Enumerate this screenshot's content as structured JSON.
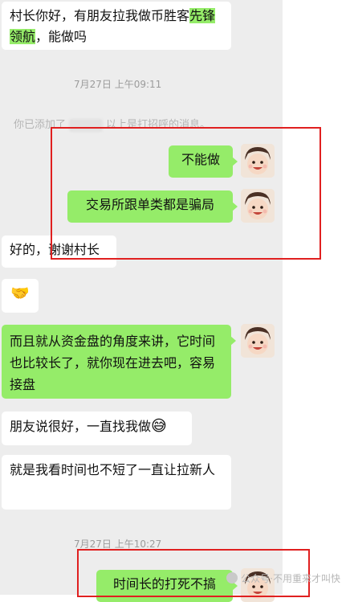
{
  "messages": [
    {
      "id": "m1",
      "side": "in",
      "parts": [
        "村长你好，有朋友拉我做币胜客",
        "先锋领航",
        "，能做吗"
      ]
    },
    {
      "id": "t1",
      "type": "time",
      "text": "7月27日 上午09:11"
    },
    {
      "id": "s1",
      "type": "system",
      "before": "你已添加了",
      "after": "以上是打招呼的消息。"
    },
    {
      "id": "m2",
      "side": "out",
      "text": "不能做"
    },
    {
      "id": "m3",
      "side": "out",
      "text": "交易所跟单类都是骗局"
    },
    {
      "id": "m4",
      "side": "in",
      "text": "好的，谢谢村长"
    },
    {
      "id": "m5",
      "side": "in",
      "emoji": "🤝"
    },
    {
      "id": "m6",
      "side": "out",
      "text": "而且就从资金盘的角度来讲，它时间也比较长了，就你现在进去吧，容易接盘"
    },
    {
      "id": "m7",
      "side": "in",
      "text": "朋友说很好，一直找我做",
      "emoji": "😅"
    },
    {
      "id": "m8",
      "side": "in",
      "text": "就是我看时间也不短了一直让拉新人"
    },
    {
      "id": "t2",
      "type": "time",
      "text": "7月27日 上午10:27"
    },
    {
      "id": "m9",
      "side": "out",
      "text": "时间长的打死不搞"
    }
  ],
  "watermark": {
    "text": "公众号·不用重来才叫快"
  },
  "colors": {
    "chat_bg": "#ededed",
    "incoming": "#ffffff",
    "outgoing": "#95ec69",
    "annotation": "#e02020"
  }
}
